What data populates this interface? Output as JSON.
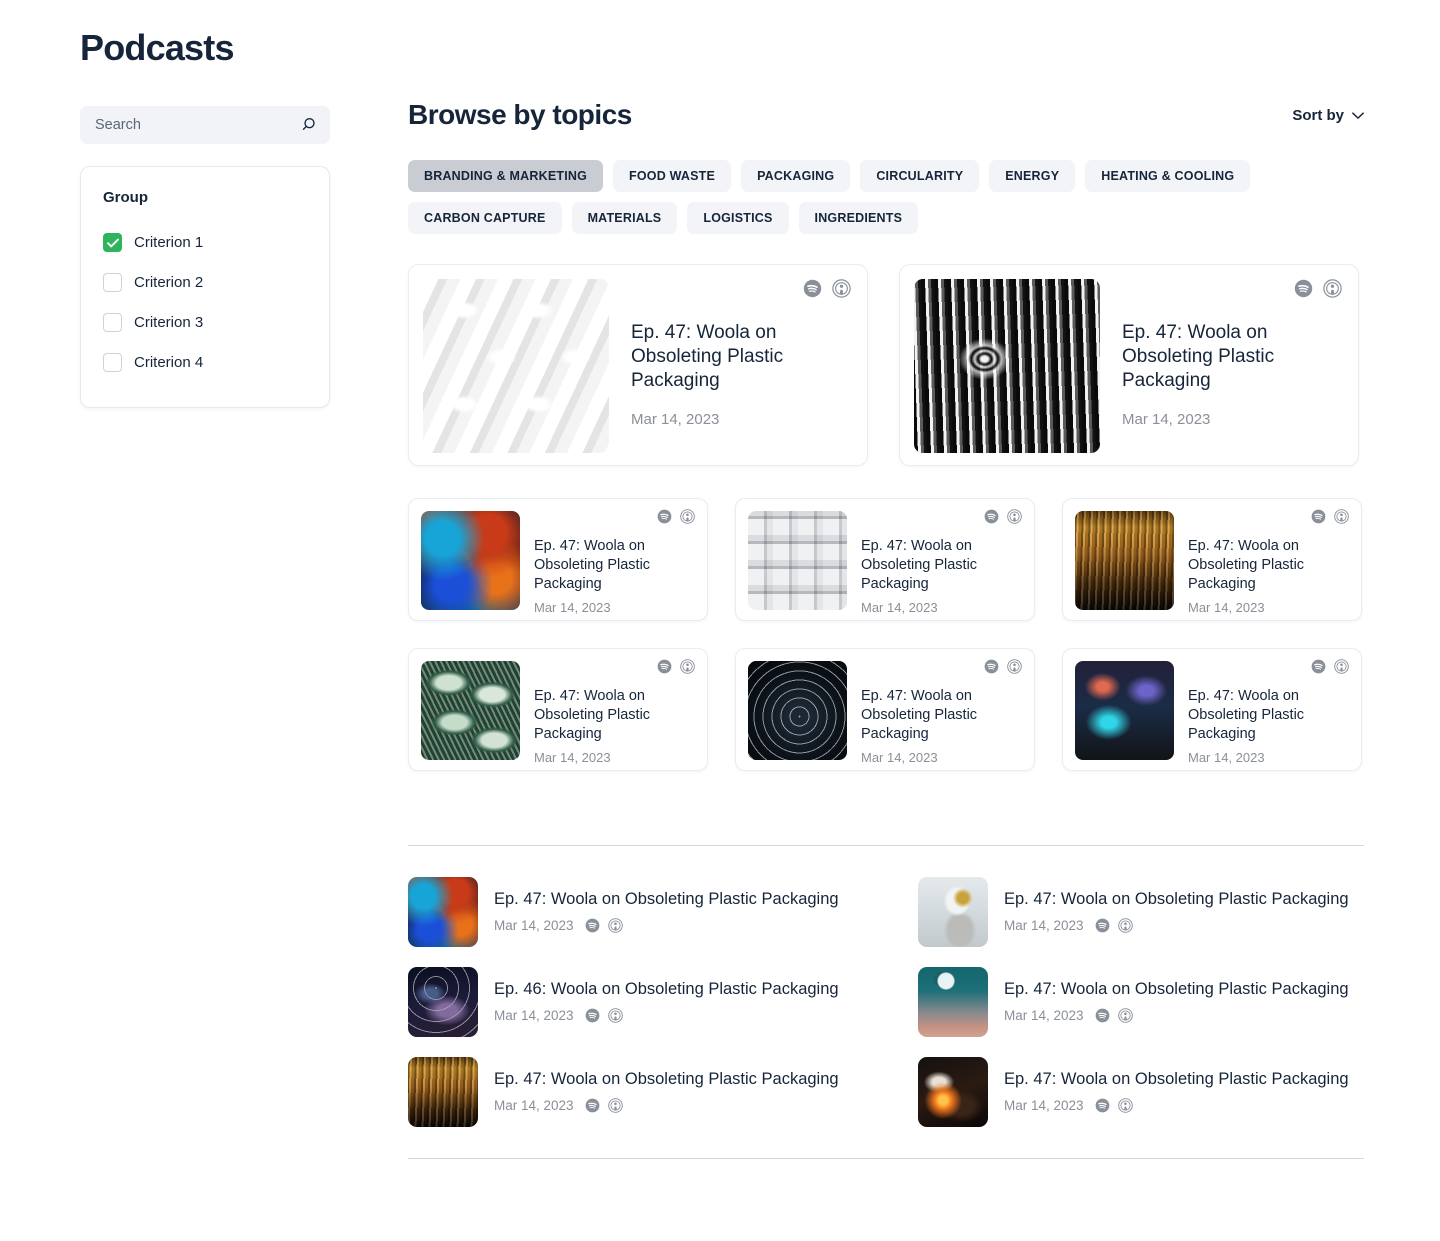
{
  "page": {
    "title": "Podcasts"
  },
  "search": {
    "placeholder": "Search",
    "value": "",
    "icon": "search-icon"
  },
  "filter": {
    "title": "Group",
    "items": [
      {
        "label": "Criterion 1",
        "checked": true
      },
      {
        "label": "Criterion 2",
        "checked": false
      },
      {
        "label": "Criterion 3",
        "checked": false
      },
      {
        "label": "Criterion 4",
        "checked": false
      }
    ],
    "accent_color": "#2FB35C"
  },
  "main": {
    "heading": "Browse by topics",
    "sort_label": "Sort by",
    "sort_icon": "chevron-down-icon"
  },
  "topics": [
    {
      "label": "BRANDING & MARKETING",
      "active": true
    },
    {
      "label": "FOOD WASTE",
      "active": false
    },
    {
      "label": "PACKAGING",
      "active": false
    },
    {
      "label": "CIRCULARITY",
      "active": false
    },
    {
      "label": "ENERGY",
      "active": false
    },
    {
      "label": "HEATING & COOLING",
      "active": false
    },
    {
      "label": "CARBON CAPTURE",
      "active": false
    },
    {
      "label": "MATERIALS",
      "active": false
    },
    {
      "label": "LOGISTICS",
      "active": false
    },
    {
      "label": "INGREDIENTS",
      "active": false
    }
  ],
  "featured": [
    {
      "title": "Ep. 47: Woola on Obsoleting Plastic Packaging",
      "date": "Mar 14, 2023",
      "art": "art-white-weave",
      "spotify_icon": "spotify-icon",
      "apple_icon": "apple-podcasts-icon"
    },
    {
      "title": "Ep. 47: Woola on Obsoleting Plastic Packaging",
      "date": "Mar 14, 2023",
      "art": "art-bw-ripple",
      "spotify_icon": "spotify-icon",
      "apple_icon": "apple-podcasts-icon"
    }
  ],
  "cards": [
    {
      "title": "Ep. 47: Woola on Obsoleting Plastic Packaging",
      "date": "Mar 14, 2023",
      "art": "art-foil"
    },
    {
      "title": "Ep. 47: Woola on Obsoleting Plastic Packaging",
      "date": "Mar 14, 2023",
      "art": "art-grid3d"
    },
    {
      "title": "Ep. 47: Woola on Obsoleting Plastic Packaging",
      "date": "Mar 14, 2023",
      "art": "art-gold-rain"
    },
    {
      "title": "Ep. 47: Woola on Obsoleting Plastic Packaging",
      "date": "Mar 14, 2023",
      "art": "art-leaves"
    },
    {
      "title": "Ep. 47: Woola on Obsoleting Plastic Packaging",
      "date": "Mar 14, 2023",
      "art": "art-star-trails"
    },
    {
      "title": "Ep. 47: Woola on Obsoleting Plastic Packaging",
      "date": "Mar 14, 2023",
      "art": "art-aurora"
    }
  ],
  "list": [
    {
      "title": "Ep. 47: Woola on Obsoleting Plastic Packaging",
      "date": "Mar 14, 2023",
      "art": "art-foil"
    },
    {
      "title": "Ep. 47: Woola on Obsoleting Plastic Packaging",
      "date": "Mar 14, 2023",
      "art": "art-astronaut"
    },
    {
      "title": "Ep. 46: Woola on Obsoleting Plastic Packaging",
      "date": "Mar 14, 2023",
      "art": "art-galaxy"
    },
    {
      "title": "Ep. 47: Woola on Obsoleting Plastic Packaging",
      "date": "Mar 14, 2023",
      "art": "art-moon"
    },
    {
      "title": "Ep. 47: Woola on Obsoleting Plastic Packaging",
      "date": "Mar 14, 2023",
      "art": "art-gold-rain"
    },
    {
      "title": "Ep. 47: Woola on Obsoleting Plastic Packaging",
      "date": "Mar 14, 2023",
      "art": "art-ember"
    }
  ],
  "icons": {
    "spotify": "spotify-icon",
    "apple_podcasts": "apple-podcasts-icon"
  }
}
